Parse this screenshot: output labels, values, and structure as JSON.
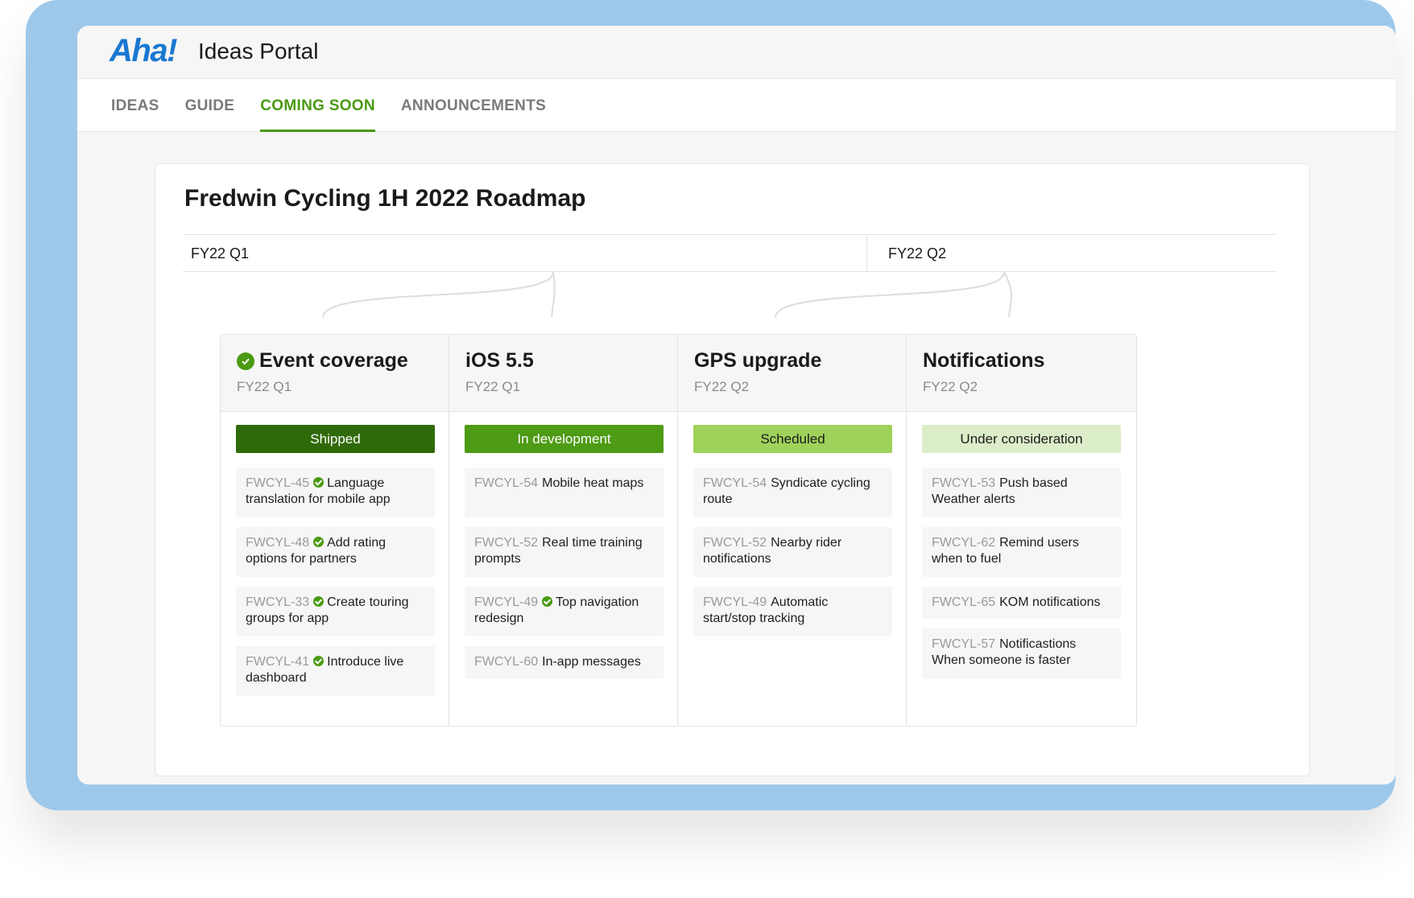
{
  "header": {
    "logo": "Aha!",
    "title": "Ideas Portal"
  },
  "nav": {
    "tabs": [
      {
        "label": "IDEAS"
      },
      {
        "label": "GUIDE"
      },
      {
        "label": "COMING SOON"
      },
      {
        "label": "ANNOUNCEMENTS"
      }
    ],
    "active_tab": "COMING SOON"
  },
  "roadmap": {
    "title": "Fredwin Cycling 1H 2022 Roadmap",
    "quarters": [
      "FY22 Q1",
      "FY22 Q2"
    ],
    "columns": [
      {
        "title": "Event coverage",
        "quarter": "FY22 Q1",
        "completed": true,
        "status": "Shipped",
        "items": [
          {
            "id": "FWCYL-45",
            "text": "Language translation for mobile app",
            "done": true
          },
          {
            "id": "FWCYL-48",
            "text": "Add rating options for partners",
            "done": true
          },
          {
            "id": "FWCYL-33",
            "text": "Create touring groups for app",
            "done": true
          },
          {
            "id": "FWCYL-41",
            "text": "Introduce live dashboard",
            "done": true
          }
        ]
      },
      {
        "title": "iOS 5.5",
        "quarter": "FY22 Q1",
        "completed": false,
        "status": "In development",
        "items": [
          {
            "id": "FWCYL-54",
            "text": "Mobile heat maps",
            "done": false
          },
          {
            "id": "FWCYL-52",
            "text": "Real time training prompts",
            "done": false
          },
          {
            "id": "FWCYL-49",
            "text": "Top navigation redesign",
            "done": true
          },
          {
            "id": "FWCYL-60",
            "text": "In-app messages",
            "done": false
          }
        ]
      },
      {
        "title": "GPS upgrade",
        "quarter": "FY22 Q2",
        "completed": false,
        "status": "Scheduled",
        "items": [
          {
            "id": "FWCYL-54",
            "text": "Syndicate cycling route",
            "done": false
          },
          {
            "id": "FWCYL-52",
            "text": "Nearby rider notifications",
            "done": false
          },
          {
            "id": "FWCYL-49",
            "text": "Automatic start/stop tracking",
            "done": false
          }
        ]
      },
      {
        "title": "Notifications",
        "quarter": "FY22 Q2",
        "completed": false,
        "status": "Under consideration",
        "items": [
          {
            "id": "FWCYL-53",
            "text": "Push based Weather alerts",
            "done": false
          },
          {
            "id": "FWCYL-62",
            "text": "Remind users when to fuel",
            "done": false
          },
          {
            "id": "FWCYL-65",
            "text": "KOM notifications",
            "done": false
          },
          {
            "id": "FWCYL-57",
            "text": "Notificastions When someone is faster",
            "done": false
          }
        ]
      }
    ]
  },
  "colors": {
    "accent": "#4a9a12",
    "shipped": "#2f6a0a",
    "in_development": "#4e9b15",
    "scheduled": "#9fd25a",
    "under_consideration": "#dcedc9",
    "logo": "#1a78d1"
  }
}
